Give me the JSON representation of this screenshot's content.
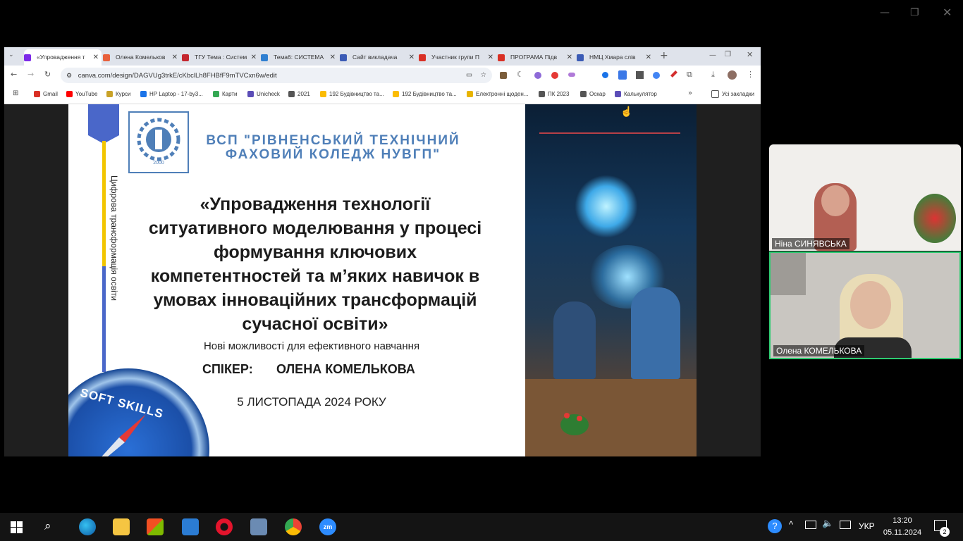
{
  "zoom_window": {
    "controls": [
      "—",
      "❐",
      "✕"
    ]
  },
  "browser": {
    "tabs": [
      {
        "label": "«Упровадження т",
        "icon_color": "#7d2ae8",
        "active": true
      },
      {
        "label": "Олена Комельков",
        "icon_color": "#e8603c",
        "active": false
      },
      {
        "label": "ТГУ Тема : Систем",
        "icon_color": "#c4262e",
        "active": false
      },
      {
        "label": "Тема6: СИСТЕМА",
        "icon_color": "#2f7fd1",
        "active": false
      },
      {
        "label": "Сайт викладача",
        "icon_color": "#3b5bb5",
        "active": false
      },
      {
        "label": "Участник групи П",
        "icon_color": "#d93025",
        "active": false
      },
      {
        "label": "ПРОГРАМА Підв",
        "icon_color": "#d93025",
        "active": false
      },
      {
        "label": "НМЦ Хмара слів",
        "icon_color": "#3b5bb5",
        "active": false
      }
    ],
    "url": "canva.com/design/DAGVUg3trkE/cKbclLh8FHBfF9mTVCxn6w/edit",
    "bookmarks": [
      {
        "label": "Gmail",
        "icon_color": "#d93025"
      },
      {
        "label": "YouTube",
        "icon_color": "#ff0000"
      },
      {
        "label": "Курси",
        "icon_color": "#c9a227"
      },
      {
        "label": "HP Laptop - 17-by3...",
        "icon_color": "#1a73e8"
      },
      {
        "label": "Карти",
        "icon_color": "#34a853"
      },
      {
        "label": "Unicheck",
        "icon_color": "#5b4db7"
      },
      {
        "label": "2021",
        "icon_color": "#555555"
      },
      {
        "label": "192 Будівництво та...",
        "icon_color": "#fbbc04"
      },
      {
        "label": "192 Будівництво та...",
        "icon_color": "#fbbc04"
      },
      {
        "label": "Електронні щоден...",
        "icon_color": "#e8b400"
      },
      {
        "label": "ПК 2023",
        "icon_color": "#555555"
      },
      {
        "label": "Оскар",
        "icon_color": "#555555"
      },
      {
        "label": "Калькулятор",
        "icon_color": "#5b4db7"
      }
    ],
    "all_bookmarks": "Усі закладки"
  },
  "slide": {
    "college_line1": "ВСП \"РІВНЕНСЬКИЙ ТЕХНІЧНИЙ",
    "college_line2": "ФАХОВИЙ КОЛЕДЖ НУВГП\"",
    "logo_year": "2000",
    "vertical_text": "Цифрова трансформація освіти",
    "title_lines": [
      "«Упровадження технології",
      "ситуативного моделювання у процесі",
      "формування ключових",
      "компетентностей та м’яких навичок в",
      "умовах інноваційних трансформацій",
      "сучасної освіти»"
    ],
    "subtitle": "Нові можливості для ефективного навчання",
    "speaker_label": "СПІКЕР:",
    "speaker_name": "ОЛЕНА КОМЕЛЬКОВА",
    "date": "5 ЛИСТОПАДА 2024 РОКУ",
    "badge_text": "SOFT SKILLS"
  },
  "participants": [
    {
      "name": "Ніна СИНЯВСЬКА",
      "active_speaker": false
    },
    {
      "name": "Олена КОМЕЛЬКОВА",
      "active_speaker": true
    }
  ],
  "taskbar": {
    "language": "УКР",
    "time": "13:20",
    "date": "05.11.2024",
    "notifications": "2"
  },
  "colors": {
    "accent_green": "#2ecc71",
    "slide_blue": "#4f7fb8",
    "stripe_yellow": "#f2c500",
    "stripe_blue": "#3d5fc4"
  }
}
